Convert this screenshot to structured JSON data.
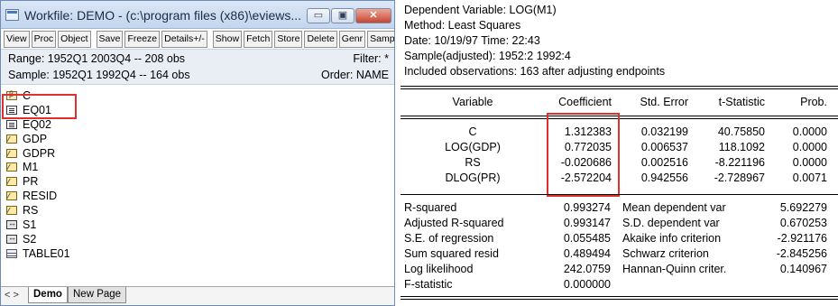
{
  "workfile": {
    "title": "Workfile: DEMO - (c:\\program files (x86)\\eviews...",
    "window_buttons": {
      "minimize": "▭",
      "maximize": "▣",
      "close": "✕"
    },
    "toolbar": [
      "View",
      "Proc",
      "Object",
      "Save",
      "Freeze",
      "Details+/-",
      "Show",
      "Fetch",
      "Store",
      "Delete",
      "Genr",
      "Sampl"
    ],
    "range_label": "Range:",
    "range_value": "1952Q1 2003Q4",
    "range_sep": "--",
    "range_obs": "208 obs",
    "sample_label": "Sample:",
    "sample_value": "1952Q1 1992Q4",
    "sample_sep": "--",
    "sample_obs": "164 obs",
    "filter": "Filter: *",
    "order": "Order: NAME",
    "objects": [
      {
        "name": "C",
        "icon": "coef-icon"
      },
      {
        "name": "EQ01",
        "icon": "equation-icon"
      },
      {
        "name": "EQ02",
        "icon": "equation-icon"
      },
      {
        "name": "GDP",
        "icon": "series-icon"
      },
      {
        "name": "GDPR",
        "icon": "series-icon"
      },
      {
        "name": "M1",
        "icon": "series-icon"
      },
      {
        "name": "PR",
        "icon": "series-icon"
      },
      {
        "name": "RESID",
        "icon": "series-icon"
      },
      {
        "name": "RS",
        "icon": "series-icon"
      },
      {
        "name": "S1",
        "icon": "scalar-icon"
      },
      {
        "name": "S2",
        "icon": "scalar-icon"
      },
      {
        "name": "TABLE01",
        "icon": "table-icon"
      }
    ],
    "tab_nav": "< >",
    "tabs": [
      "Demo",
      "New Page"
    ],
    "highlight_color": "#e0302c"
  },
  "output": {
    "header": [
      "Dependent Variable: LOG(M1)",
      "Method: Least Squares",
      "Date: 10/19/97   Time: 22:43",
      "Sample(adjusted): 1952:2 1992:4",
      "Included observations: 163 after adjusting endpoints"
    ],
    "columns": [
      "Variable",
      "Coefficient",
      "Std. Error",
      "t-Statistic",
      "Prob."
    ],
    "rows": [
      {
        "variable": "C",
        "coef": "1.312383",
        "se": "0.032199",
        "t": "40.75850",
        "p": "0.0000"
      },
      {
        "variable": "LOG(GDP)",
        "coef": "0.772035",
        "se": "0.006537",
        "t": "118.1092",
        "p": "0.0000"
      },
      {
        "variable": "RS",
        "coef": "-0.020686",
        "se": "0.002516",
        "t": "-8.221196",
        "p": "0.0000"
      },
      {
        "variable": "DLOG(PR)",
        "coef": "-2.572204",
        "se": "0.942556",
        "t": "-2.728967",
        "p": "0.0071"
      }
    ],
    "stats": [
      {
        "l1": "R-squared",
        "v1": "0.993274",
        "l2": "Mean dependent var",
        "v2": "5.692279"
      },
      {
        "l1": "Adjusted R-squared",
        "v1": "0.993147",
        "l2": "S.D. dependent var",
        "v2": "0.670253"
      },
      {
        "l1": "S.E. of regression",
        "v1": "0.055485",
        "l2": "Akaike info criterion",
        "v2": "-2.921176"
      },
      {
        "l1": "Sum squared resid",
        "v1": "0.489494",
        "l2": "Schwarz criterion",
        "v2": "-2.845256"
      },
      {
        "l1": "Log likelihood",
        "v1": "242.0759",
        "l2": "Hannan-Quinn criter.",
        "v2": "0.140967"
      },
      {
        "l1": "F-statistic",
        "v1": "0.000000",
        "l2": "",
        "v2": ""
      }
    ]
  }
}
